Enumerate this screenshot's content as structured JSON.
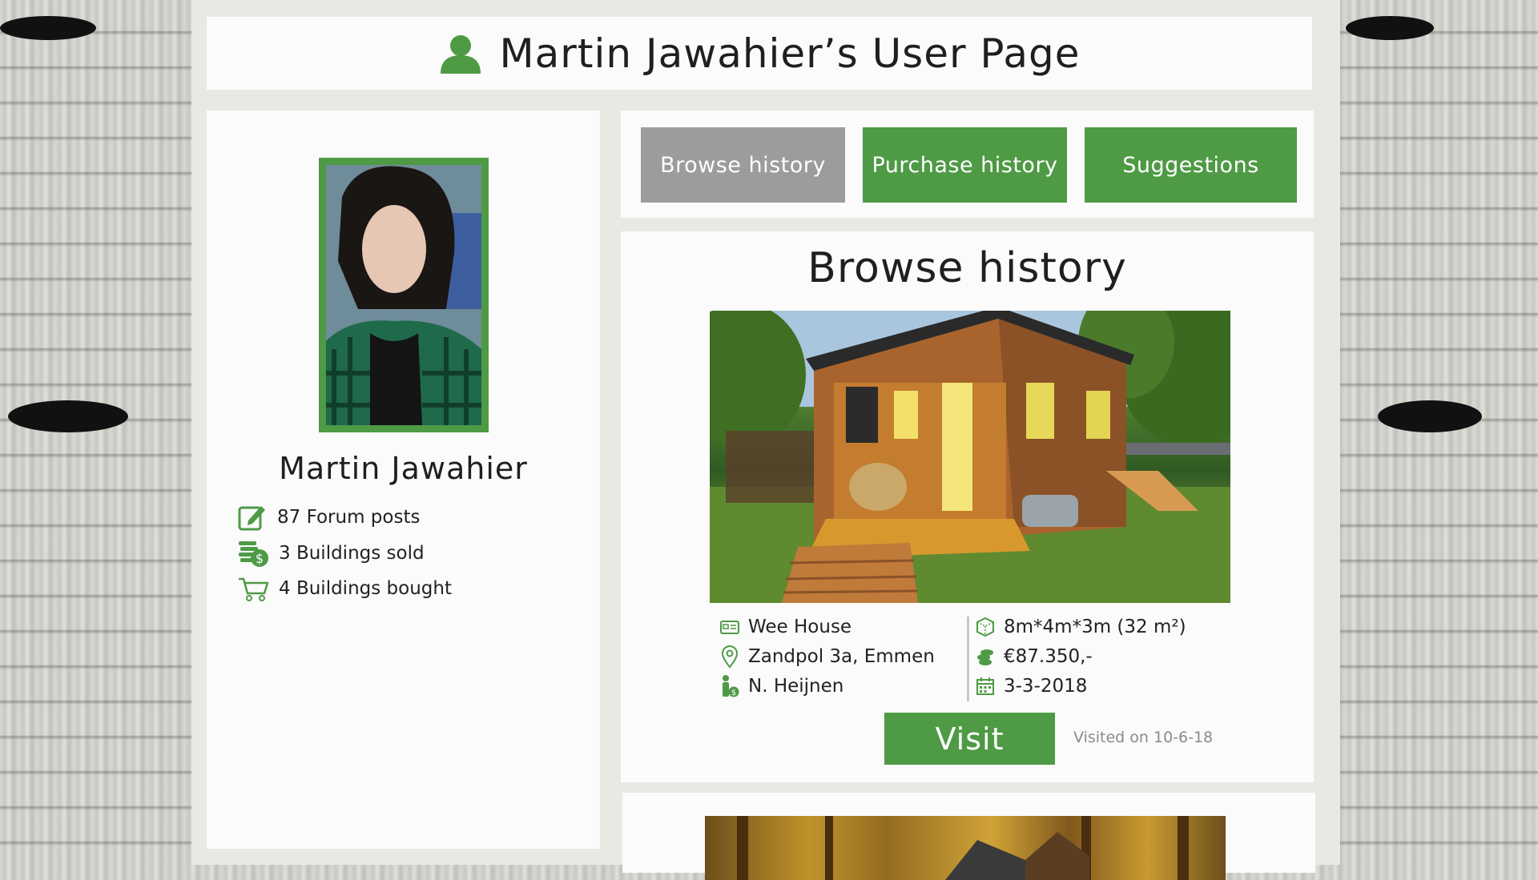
{
  "header": {
    "title": "Martin Jawahier’s User Page",
    "icon": "user-icon"
  },
  "profile": {
    "name": "Martin Jawahier",
    "stats": [
      {
        "icon": "edit-icon",
        "label": "87 Forum posts"
      },
      {
        "icon": "coins-dollar-icon",
        "label": "3 Buildings sold"
      },
      {
        "icon": "cart-icon",
        "label": "4 Buildings bought"
      }
    ]
  },
  "tabs": [
    {
      "label": "Browse history",
      "active": true
    },
    {
      "label": "Purchase history",
      "active": false
    },
    {
      "label": "Suggestions",
      "active": false
    }
  ],
  "listing": {
    "section_title": "Browse history",
    "left": [
      {
        "icon": "id-card-icon",
        "text": "Wee House"
      },
      {
        "icon": "location-pin-icon",
        "text": "Zandpol 3a, Emmen"
      },
      {
        "icon": "seller-icon",
        "text": "N. Heijnen"
      }
    ],
    "right": [
      {
        "icon": "cube-icon",
        "text": "8m*4m*3m (32 m²)"
      },
      {
        "icon": "coins-icon",
        "text": "€87.350,-"
      },
      {
        "icon": "calendar-icon",
        "text": "3-3-2018"
      }
    ],
    "visit_label": "Visit",
    "visited_text": "Visited on 10-6-18"
  },
  "colors": {
    "accent": "#4e9a45",
    "tab_inactive": "#9c9c9c",
    "panel": "#fafbfa",
    "frame": "#e9e9e4"
  }
}
